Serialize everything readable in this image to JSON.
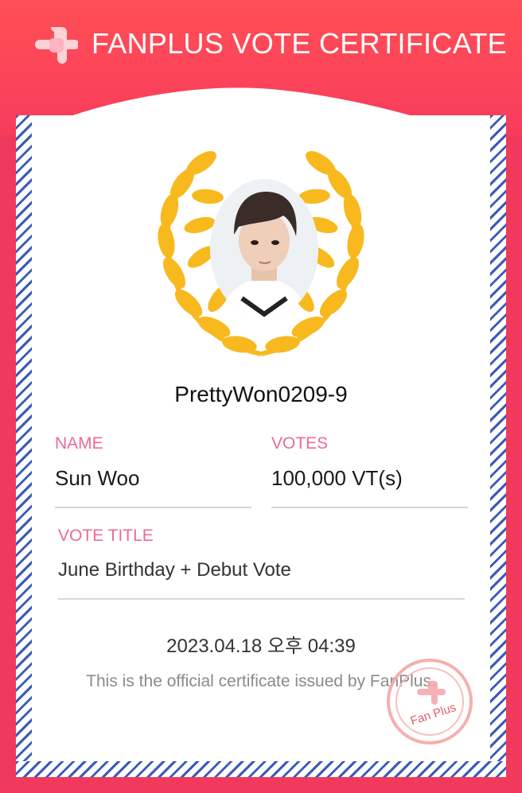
{
  "header": {
    "title": "FANPLUS VOTE CERTIFICATE"
  },
  "certificate": {
    "username": "PrettyWon0209-9",
    "name_label": "NAME",
    "name_value": "Sun Woo",
    "votes_label": "VOTES",
    "votes_value": "100,000 VT(s)",
    "vote_title_label": "VOTE TITLE",
    "vote_title_value": "June Birthday + Debut Vote",
    "datetime": "2023.04.18 오후 04:39",
    "official_note": "This is the official certificate issued by FanPlus.",
    "stamp_text": "Fan Plus"
  },
  "colors": {
    "brand_red": "#f83c5c",
    "label_pink": "#ef6b91",
    "stripe_blue": "#3a5bb5",
    "laurel_gold": "#f7b91e"
  }
}
